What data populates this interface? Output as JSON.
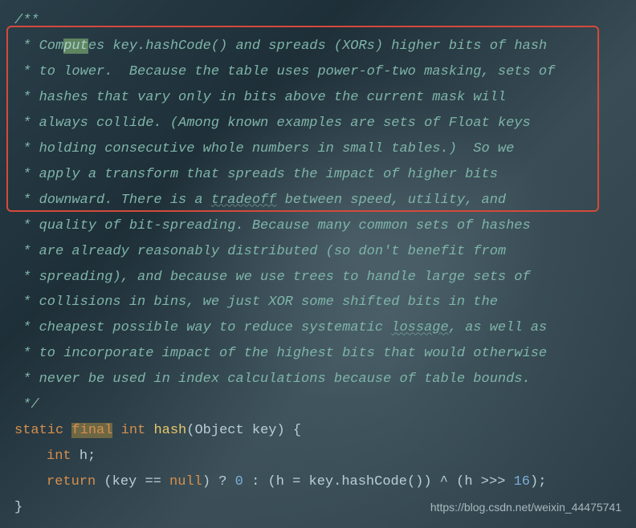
{
  "comment": {
    "l0": "/**",
    "l1_a": " * Com",
    "l1_hl": "put",
    "l1_b": "es key.hashCode() and spreads (XORs) higher bits of hash",
    "l2": " * to lower.  Because the table uses power-of-two masking, sets of",
    "l3": " * hashes that vary only in bits above the current mask will",
    "l4": " * always collide. (Among known examples are sets of Float keys",
    "l5": " * holding consecutive whole numbers in small tables.)  So we",
    "l6": " * apply a transform that spreads the impact of higher bits",
    "l7_a": " * downward. There is a ",
    "l7_wavy": "tradeoff",
    "l7_b": " between speed, utility, and",
    "l8": " * quality of bit-spreading. Because many common sets of hashes",
    "l9": " * are already reasonably distributed (so don't benefit from",
    "l10": " * spreading), and because we use trees to handle large sets of",
    "l11": " * collisions in bins, we just XOR some shifted bits in the",
    "l12_a": " * cheapest possible way to reduce systematic ",
    "l12_wavy": "lossage",
    "l12_b": ", as well as",
    "l13": " * to incorporate impact of the highest bits that would otherwise",
    "l14": " * never be used in index calculations because of table bounds.",
    "l15": " */"
  },
  "code": {
    "static": "static",
    "final": "final",
    "int": "int",
    "hash": "hash",
    "object": "Object",
    "key": "key",
    "lparen": "(",
    "rparen": ")",
    "lbrace": "{",
    "rbrace": "}",
    "space": " ",
    "h": "h",
    "semi": ";",
    "return": "return",
    "eq": "==",
    "null": "null",
    "qmark": "?",
    "zero": "0",
    "colon": ":",
    "assign": "=",
    "dot": ".",
    "hashcode": "hashCode",
    "caret": "^",
    "shift": ">>>",
    "sixteen": "16"
  },
  "watermark": "https://blog.csdn.net/weixin_44475741"
}
